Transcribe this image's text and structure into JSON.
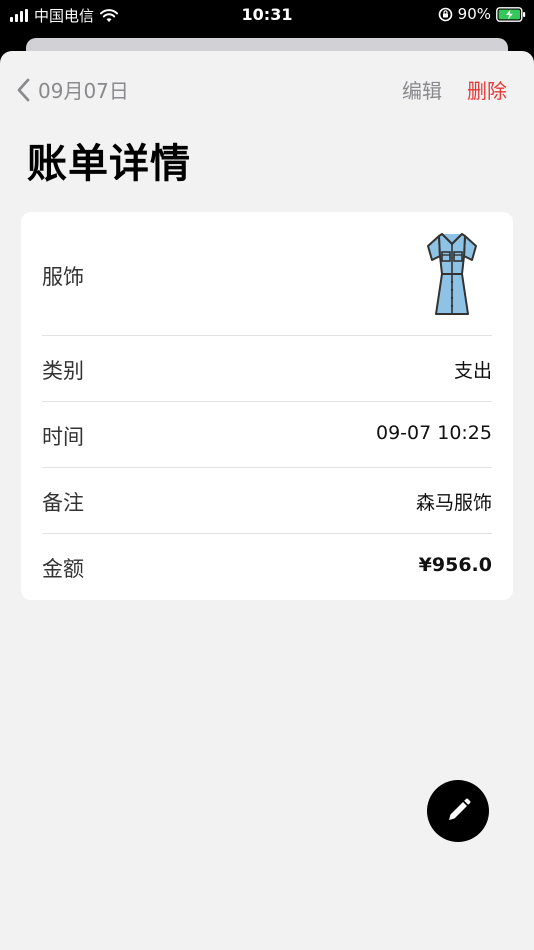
{
  "status_bar": {
    "carrier": "中国电信",
    "time": "10:31",
    "battery": "90%"
  },
  "nav": {
    "back_label": "09月07日",
    "edit_label": "编辑",
    "delete_label": "删除",
    "delete_color": "#e53935"
  },
  "page": {
    "title": "账单详情"
  },
  "detail": {
    "category": "服饰",
    "category_icon": "dress-icon",
    "rows": [
      {
        "label": "类别",
        "value": "支出"
      },
      {
        "label": "时间",
        "value": "09-07 10:25"
      },
      {
        "label": "备注",
        "value": "森马服饰"
      },
      {
        "label": "金额",
        "value": "¥956.0"
      }
    ]
  },
  "fab": {
    "icon": "pencil-icon"
  }
}
